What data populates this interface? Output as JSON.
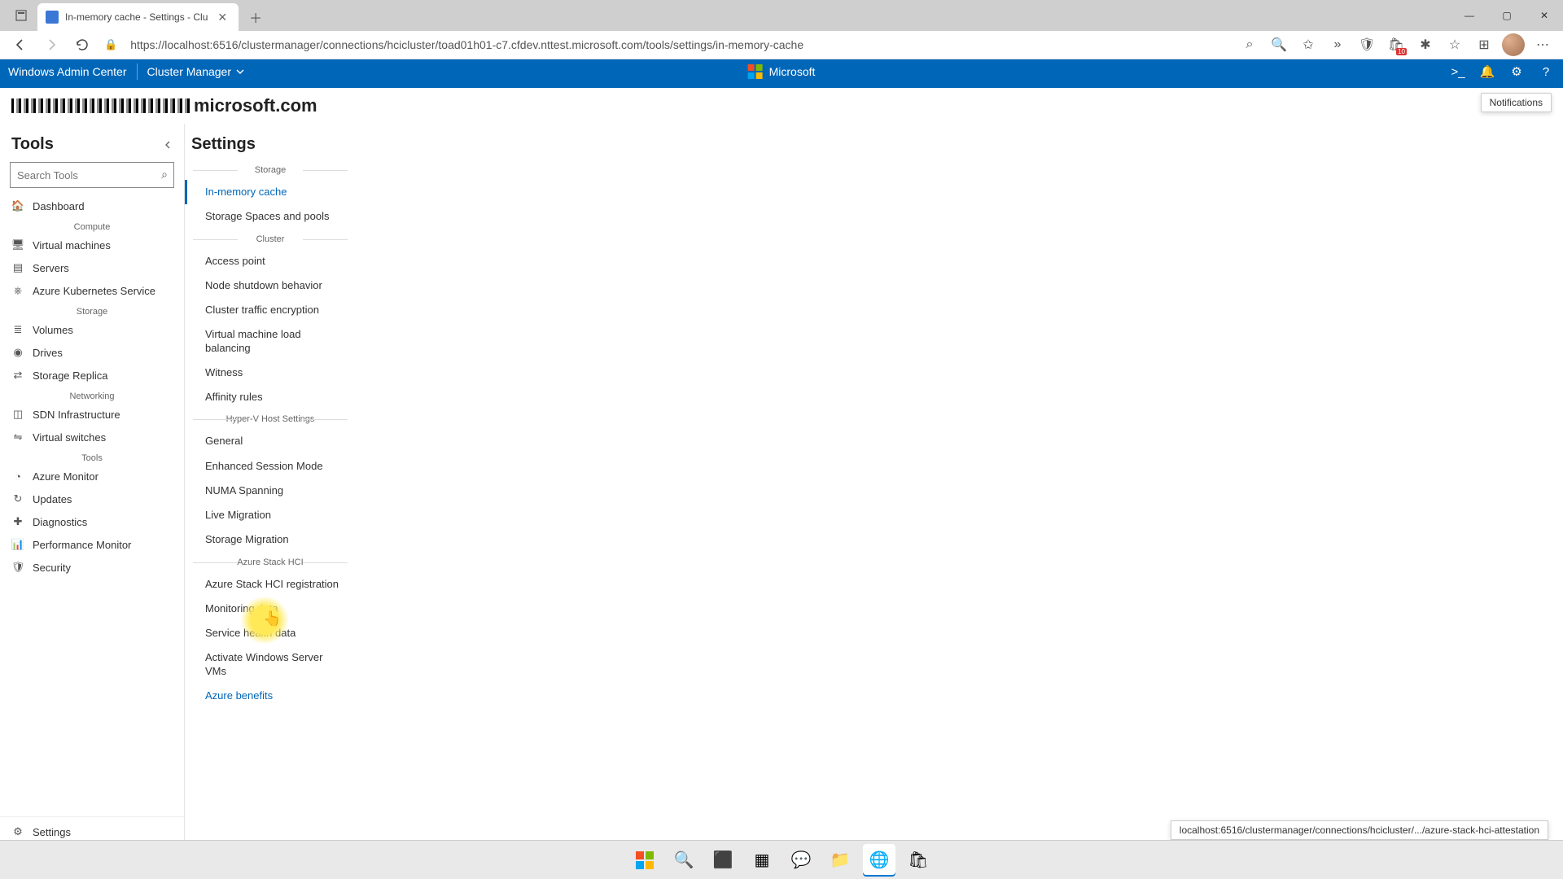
{
  "browser": {
    "tab_title": "In-memory cache - Settings - Clu",
    "url": "https://localhost:6516/clustermanager/connections/hcicluster/toad01h01-c7.cfdev.nttest.microsoft.com/tools/settings/in-memory-cache"
  },
  "wac_header": {
    "product": "Windows Admin Center",
    "context": "Cluster Manager",
    "brand": "Microsoft"
  },
  "hostline": {
    "suffix": "microsoft.com"
  },
  "notifications_tooltip": "Notifications",
  "tools": {
    "title": "Tools",
    "search_placeholder": "Search Tools",
    "groups": [
      {
        "label": "",
        "items": [
          {
            "icon": "home",
            "label": "Dashboard"
          }
        ]
      },
      {
        "label": "Compute",
        "items": [
          {
            "icon": "vm",
            "label": "Virtual machines"
          },
          {
            "icon": "server",
            "label": "Servers"
          },
          {
            "icon": "aks",
            "label": "Azure Kubernetes Service"
          }
        ]
      },
      {
        "label": "Storage",
        "items": [
          {
            "icon": "volume",
            "label": "Volumes"
          },
          {
            "icon": "drive",
            "label": "Drives"
          },
          {
            "icon": "replica",
            "label": "Storage Replica"
          }
        ]
      },
      {
        "label": "Networking",
        "items": [
          {
            "icon": "sdn",
            "label": "SDN Infrastructure"
          },
          {
            "icon": "vswitch",
            "label": "Virtual switches"
          }
        ]
      },
      {
        "label": "Tools",
        "items": [
          {
            "icon": "monitor",
            "label": "Azure Monitor"
          },
          {
            "icon": "updates",
            "label": "Updates"
          },
          {
            "icon": "diag",
            "label": "Diagnostics"
          },
          {
            "icon": "perf",
            "label": "Performance Monitor"
          },
          {
            "icon": "security",
            "label": "Security"
          }
        ]
      }
    ],
    "footer": {
      "icon": "gear",
      "label": "Settings"
    }
  },
  "settings": {
    "title": "Settings",
    "groups": [
      {
        "label": "Storage",
        "items": [
          {
            "label": "In-memory cache",
            "active": true
          },
          {
            "label": "Storage Spaces and pools"
          }
        ]
      },
      {
        "label": "Cluster",
        "items": [
          {
            "label": "Access point"
          },
          {
            "label": "Node shutdown behavior"
          },
          {
            "label": "Cluster traffic encryption"
          },
          {
            "label": "Virtual machine load balancing"
          },
          {
            "label": "Witness"
          },
          {
            "label": "Affinity rules"
          }
        ]
      },
      {
        "label": "Hyper-V Host Settings",
        "items": [
          {
            "label": "General"
          },
          {
            "label": "Enhanced Session Mode"
          },
          {
            "label": "NUMA Spanning"
          },
          {
            "label": "Live Migration"
          },
          {
            "label": "Storage Migration"
          }
        ]
      },
      {
        "label": "Azure Stack HCI",
        "items": [
          {
            "label": "Azure Stack HCI registration"
          },
          {
            "label": "Monitoring data"
          },
          {
            "label": "Service health data"
          },
          {
            "label": "Activate Windows Server VMs"
          },
          {
            "label": "Azure benefits",
            "hover": true
          }
        ]
      }
    ]
  },
  "status_url": "localhost:6516/clustermanager/connections/hcicluster/.../azure-stack-hci-attestation",
  "colors": {
    "accent": "#0066b8"
  }
}
